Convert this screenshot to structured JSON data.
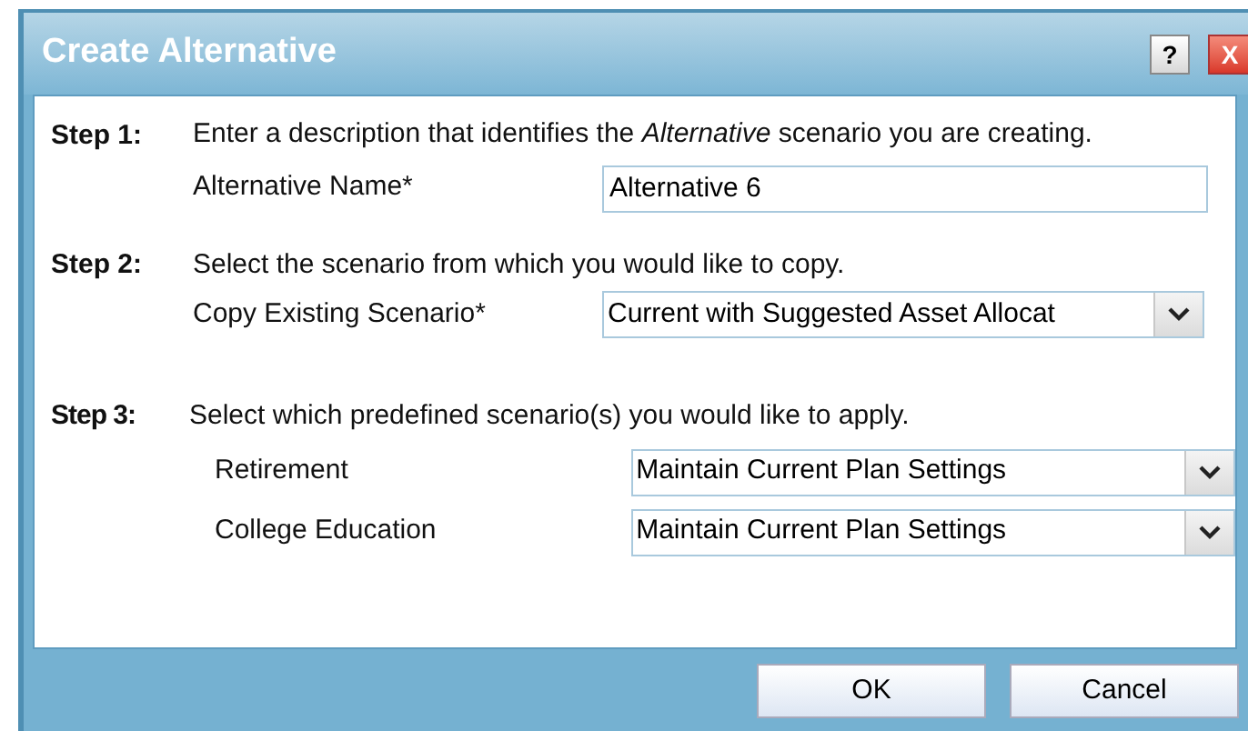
{
  "window": {
    "title": "Create Alternative",
    "help_button": "?",
    "close_button": "X"
  },
  "step1": {
    "label": "Step 1:",
    "instruction": "Enter a description that identifies the *Alternative* scenario you are creating.",
    "field_label": "Alternative Name*",
    "value": "Alternative 6"
  },
  "step2": {
    "label": "Step 2:",
    "instruction": "Select the scenario from which you would like to copy.",
    "field_label": "Copy Existing Scenario*",
    "value": "Current with Suggested Asset Allocat"
  },
  "step3": {
    "label": "Step 3:",
    "instruction": "Select which predefined scenario(s) you would like to apply.",
    "rows": [
      {
        "label": "Retirement",
        "value": "Maintain Current Plan Settings"
      },
      {
        "label": "College Education",
        "value": "Maintain Current Plan Settings"
      }
    ]
  },
  "buttons": [
    "OK",
    "Cancel"
  ]
}
